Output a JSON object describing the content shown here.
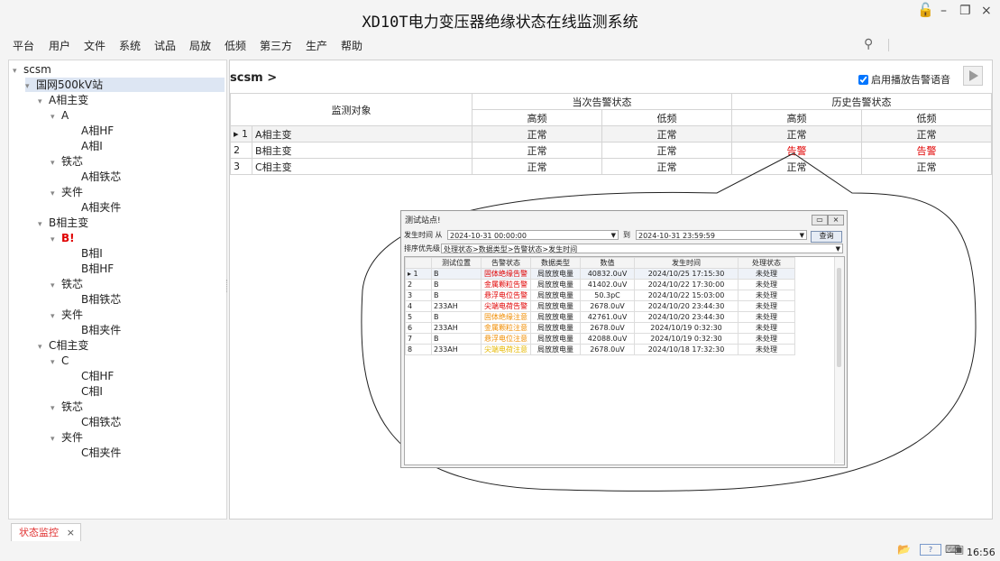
{
  "app": {
    "title": "XD10T电力变压器绝缘状态在线监测系统",
    "controls": {
      "lock": "🔓",
      "minimize": "–",
      "restore": "❐",
      "close": "×"
    }
  },
  "menu": [
    "平台",
    "用户",
    "文件",
    "系统",
    "试品",
    "局放",
    "低频",
    "第三方",
    "生产",
    "帮助"
  ],
  "tree": [
    {
      "label": "scsm",
      "toggle": "▾"
    },
    {
      "label": "国网500kV站",
      "toggle": "▾"
    },
    {
      "label": "A相主变",
      "toggle": "▾"
    },
    {
      "label": "A",
      "toggle": "▾"
    },
    {
      "label": "A相HF",
      "toggle": ""
    },
    {
      "label": "A相I",
      "toggle": ""
    },
    {
      "label": "铁芯",
      "toggle": "▾"
    },
    {
      "label": "A相铁芯",
      "toggle": ""
    },
    {
      "label": "夹件",
      "toggle": "▾"
    },
    {
      "label": "A相夹件",
      "toggle": ""
    },
    {
      "label": "B相主变",
      "toggle": "▾"
    },
    {
      "label": "B!",
      "toggle": "▾"
    },
    {
      "label": "B相I",
      "toggle": ""
    },
    {
      "label": "B相HF",
      "toggle": ""
    },
    {
      "label": "铁芯",
      "toggle": "▾"
    },
    {
      "label": "B相铁芯",
      "toggle": ""
    },
    {
      "label": "夹件",
      "toggle": "▾"
    },
    {
      "label": "B相夹件",
      "toggle": ""
    },
    {
      "label": "C相主变",
      "toggle": "▾"
    },
    {
      "label": "C",
      "toggle": "▾"
    },
    {
      "label": "C相HF",
      "toggle": ""
    },
    {
      "label": "C相I",
      "toggle": ""
    },
    {
      "label": "铁芯",
      "toggle": "▾"
    },
    {
      "label": "C相铁芯",
      "toggle": ""
    },
    {
      "label": "夹件",
      "toggle": "▾"
    },
    {
      "label": "C相夹件",
      "toggle": ""
    }
  ],
  "main": {
    "breadcrumb": "scsm >",
    "voice_label": "启用播放告警语音",
    "headers": {
      "target": "监测对象",
      "current": "当次告警状态",
      "history": "历史告警状态",
      "high": "高频",
      "low": "低频"
    },
    "rows": [
      {
        "marker": "▸ 1",
        "target": "A相主变",
        "cur_high": "正常",
        "cur_low": "正常",
        "his_high": "正常",
        "his_low": "正常"
      },
      {
        "marker": "2",
        "target": "B相主变",
        "cur_high": "正常",
        "cur_low": "正常",
        "his_high": "告警",
        "his_low": "告警"
      },
      {
        "marker": "3",
        "target": "C相主变",
        "cur_high": "正常",
        "cur_low": "正常",
        "his_high": "正常",
        "his_low": "正常"
      }
    ]
  },
  "popup": {
    "title": "测试站点!",
    "from_label": "发生时间 从",
    "from_value": "2024-10-31 00:00:00",
    "to_label": "到",
    "to_value": "2024-10-31 23:59:59",
    "query": "查询",
    "sort_label": "排序优先级",
    "sort_value": "处理状态>数据类型>告警状态>发生时间",
    "columns": [
      "测试位置",
      "告警状态",
      "数据类型",
      "数值",
      "发生时间",
      "处理状态"
    ],
    "rows": [
      {
        "n": "▸ 1",
        "pos": "B",
        "alarm": "固体绝缘告警",
        "level": "red",
        "type": "局放放电量",
        "value": "40832.0uV",
        "time": "2024/10/25 17:15:30",
        "state": "未处理"
      },
      {
        "n": "2",
        "pos": "B",
        "alarm": "金属颗粒告警",
        "level": "red",
        "type": "局放放电量",
        "value": "41402.0uV",
        "time": "2024/10/22 17:30:00",
        "state": "未处理"
      },
      {
        "n": "3",
        "pos": "B",
        "alarm": "悬浮电位告警",
        "level": "red",
        "type": "局放放电量",
        "value": "50.3pC",
        "time": "2024/10/22 15:03:00",
        "state": "未处理"
      },
      {
        "n": "4",
        "pos": "233AH",
        "alarm": "尖端电荷告警",
        "level": "red",
        "type": "局放放电量",
        "value": "2678.0uV",
        "time": "2024/10/20 23:44:30",
        "state": "未处理"
      },
      {
        "n": "5",
        "pos": "B",
        "alarm": "固体绝缘注意",
        "level": "orange",
        "type": "局放放电量",
        "value": "42761.0uV",
        "time": "2024/10/20 23:44:30",
        "state": "未处理"
      },
      {
        "n": "6",
        "pos": "233AH",
        "alarm": "金属颗粒注意",
        "level": "orange",
        "type": "局放放电量",
        "value": "2678.0uV",
        "time": "2024/10/19 0:32:30",
        "state": "未处理"
      },
      {
        "n": "7",
        "pos": "B",
        "alarm": "悬浮电位注意",
        "level": "orange",
        "type": "局放放电量",
        "value": "42088.0uV",
        "time": "2024/10/19 0:32:30",
        "state": "未处理"
      },
      {
        "n": "8",
        "pos": "233AH",
        "alarm": "尖端电荷注意",
        "level": "yellow",
        "type": "局放放电量",
        "value": "2678.0uV",
        "time": "2024/10/18 17:32:30",
        "state": "未处理"
      }
    ]
  },
  "tabs": [
    {
      "label": "状态监控",
      "close": "×"
    }
  ],
  "statusbar": {
    "time": "16:56"
  },
  "colors": {
    "alarm": "#e00000",
    "attention": "#f08c00",
    "note": "#e6b800",
    "selection": "#dde6f3"
  }
}
